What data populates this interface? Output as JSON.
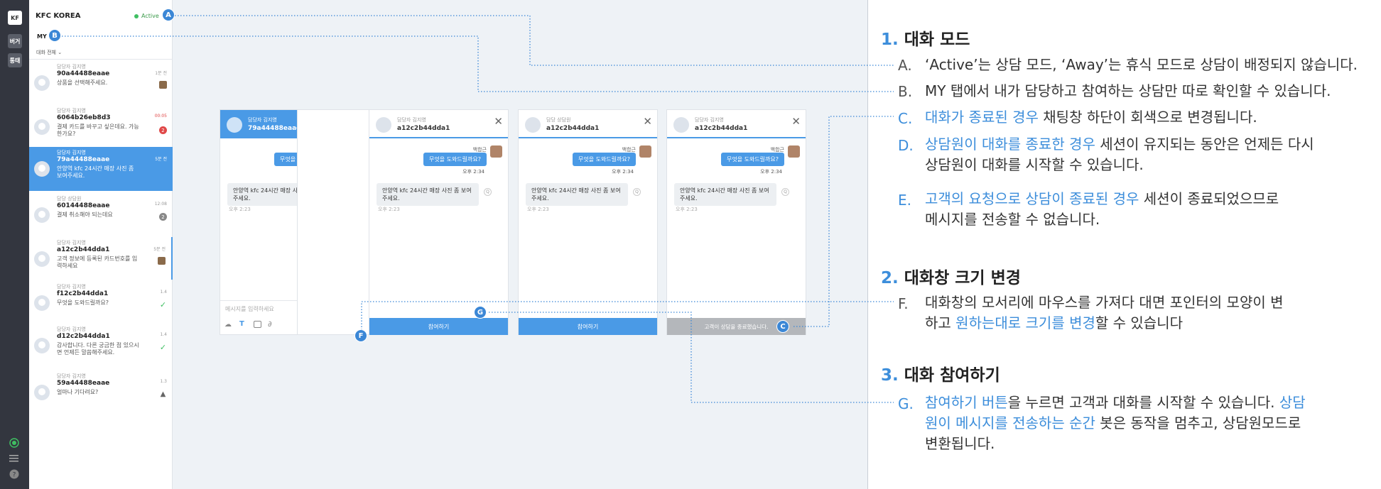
{
  "sidebar_rail": {
    "logo": "KF",
    "btn1": "버거",
    "btn2": "통태"
  },
  "list": {
    "title": "KFC KOREA",
    "status": "Active",
    "tab": "MY",
    "filter": "대화 전체",
    "items": [
      {
        "agent": "담당자 김지영",
        "id": "90a44488eaae",
        "msg": "상품을 선택해주세요.",
        "time": "1분 전",
        "badge": ""
      },
      {
        "agent": "담당자 김지영",
        "id": "6064b26eb8d3",
        "msg": "결제 카드를 바꾸고 싶은데요. 가능한가요?",
        "time": "00:05",
        "badge": "2"
      },
      {
        "agent": "담당자 김지영",
        "id": "79a44488eaae",
        "msg": "안양역 kfc 24시간 매장 사진 좀 보여주세요.",
        "time": "5분 전",
        "badge": ""
      },
      {
        "agent": "담당 상담원",
        "id": "60144488eaae",
        "msg": "결제 취소해야 되는데요",
        "time": "12:08",
        "badge": "2"
      },
      {
        "agent": "담당자 김지영",
        "id": "a12c2b44dda1",
        "msg": "고객 정보에 등록된 카드번호를 입력하세요",
        "time": "5분 전",
        "badge": ""
      },
      {
        "agent": "담당자 김지영",
        "id": "f12c2b44dda1",
        "msg": "무엇을 도와드릴까요?",
        "time": "1.4",
        "badge": ""
      },
      {
        "agent": "담당자 김지영",
        "id": "d12c2b44dda1",
        "msg": "감사합니다. 다른 궁금한 점 있으시면 언제든 말씀해주세요.",
        "time": "1.4",
        "badge": ""
      },
      {
        "agent": "담당자 김지영",
        "id": "59a44488eaae",
        "msg": "얼마나 기다려요?",
        "time": "1.3",
        "badge": ""
      }
    ]
  },
  "windows": [
    {
      "agent": "담당자 김지영",
      "id": "79a44488eaae",
      "footer": ""
    },
    {
      "agent": "담당자 김지영",
      "id": "a12c2b44dda1",
      "footer": "참여하기"
    },
    {
      "agent": "담당 상담원",
      "id": "a12c2b44dda1",
      "footer": "참여하기"
    },
    {
      "agent": "담당자 김지영",
      "id": "a12c2b44dda1",
      "footer": "고객이 상담을 종료했습니다."
    }
  ],
  "chat": {
    "agent_name": "백합근",
    "bubble": "무엇을 도와드릴까요?",
    "bubble_time": "오후 2:34",
    "customer_msg": "안양역 kfc 24시간 매장 사진 좀 보여주세요.",
    "customer_time": "오후 2:23",
    "input_placeholder": "메시지를 입력하세요",
    "close": "✕",
    "q": "Q"
  },
  "markers": {
    "A": "A",
    "B": "B",
    "C": "C",
    "F": "F",
    "G": "G"
  },
  "right": {
    "s1": {
      "num": "1.",
      "title": "대화 모드"
    },
    "a": {
      "letter": "A.",
      "text": "‘Active’는 상담 모드, ‘Away’는 휴식 모드로 상담이 배정되지 않습니다."
    },
    "b": {
      "letter": "B.",
      "text": "MY 탭에서 내가 담당하고 참여하는 상담만 따로 확인할 수 있습니다."
    },
    "c": {
      "letter": "C.",
      "hl": "대화가 종료된 경우",
      "text": " 채팅창 하단이 회색으로 변경됩니다."
    },
    "d": {
      "letter": "D.",
      "hl": "상담원이 대화를 종료한 경우",
      "text": " 세션이 유지되는 동안은 언제든 다시",
      "line2": "상담원이 대화를 시작할 수 있습니다."
    },
    "e": {
      "letter": "E.",
      "hl": "고객의 요청으로 상담이 종료된 경우",
      "text": " 세션이 종료되었으므로",
      "line2": "메시지를 전송할 수 없습니다."
    },
    "s2": {
      "num": "2.",
      "title": "대화창 크기 변경"
    },
    "f": {
      "letter": "F.",
      "line1": "대화창의 모서리에 마우스를 가져다 대면 포인터의 모양이 변",
      "pre": "하고 ",
      "hl": "원하는대로 크기를 변경",
      "post": "할 수 있습니다"
    },
    "s3": {
      "num": "3.",
      "title": "대화 참여하기"
    },
    "g": {
      "letter": "G.",
      "hl": "참여하기 버튼",
      "text": "을 누르면 고객과 대화를 시작할 수 있습니다. ",
      "hl2": "상담",
      "hl3": "원이 메시지를 전송하는 순간",
      "line2": " 봇은 동작을 멈추고, 상담원모드로",
      "line3": "변환됩니다."
    }
  },
  "colors": {
    "accent": "#4a9ae6",
    "rail": "#33363f",
    "disabled": "#b4b7bb"
  }
}
